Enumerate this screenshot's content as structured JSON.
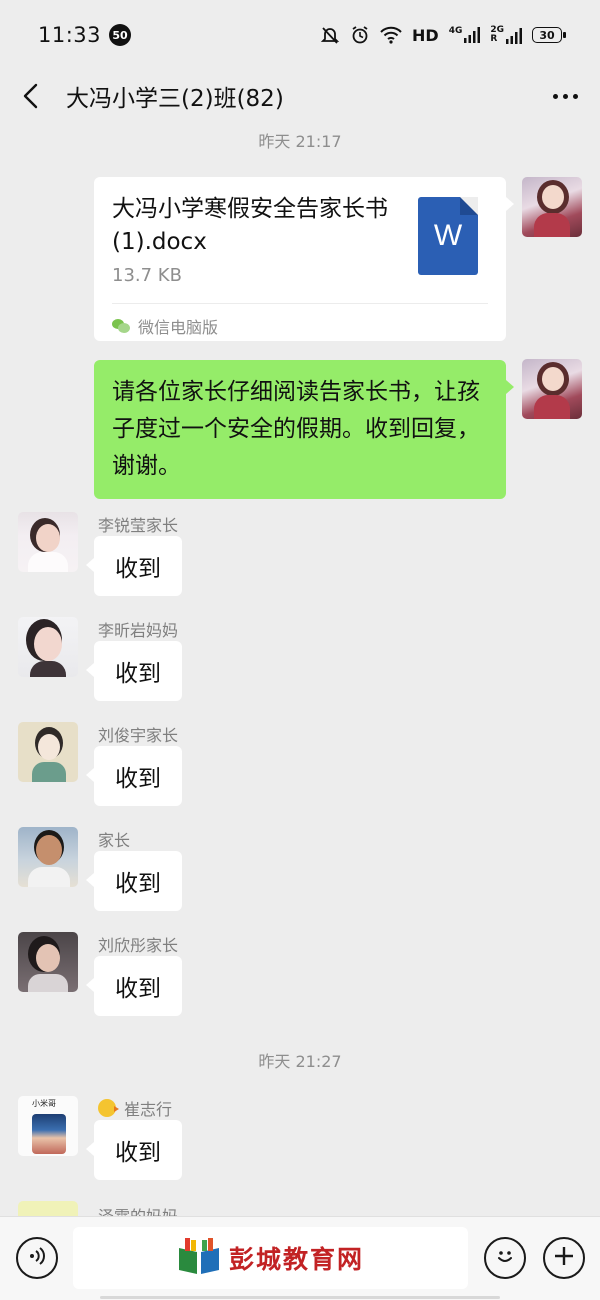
{
  "status_bar": {
    "time": "11:33",
    "notification_count": "50",
    "hd": "HD",
    "net_4g": "4G",
    "net_2g": "2G",
    "roaming": "R",
    "battery": "30"
  },
  "header": {
    "title": "大冯小学三(2)班(82)"
  },
  "timestamps": [
    "昨天 21:17",
    "昨天 21:27"
  ],
  "own_messages": {
    "file": {
      "name": "大冯小学寒假安全告家长书(1).docx",
      "size": "13.7 KB",
      "icon_letter": "W",
      "source": "微信电脑版"
    },
    "text": "请各位家长仔细阅读告家长书，让孩子度过一个安全的假期。收到回复，谢谢。"
  },
  "replies": [
    {
      "sender": "李锐莹家长",
      "text": "收到"
    },
    {
      "sender": "李昕岩妈妈",
      "text": "收到"
    },
    {
      "sender": "刘俊宇家长",
      "text": "收到"
    },
    {
      "sender": "家长",
      "text": "收到"
    },
    {
      "sender": "刘欣彤家长",
      "text": "收到"
    },
    {
      "sender": "崔志行",
      "text": "收到"
    },
    {
      "sender": "泽霖的妈妈",
      "text": ""
    }
  ],
  "avatar_labels": {
    "cui_avatar": "小米哥"
  },
  "input_bar": {
    "watermark": "彭城教育网"
  },
  "colors": {
    "background": "#ededed",
    "own_bubble": "#95ec69",
    "other_bubble": "#ffffff",
    "word_icon": "#2b5fb4",
    "watermark": "#c22224"
  }
}
